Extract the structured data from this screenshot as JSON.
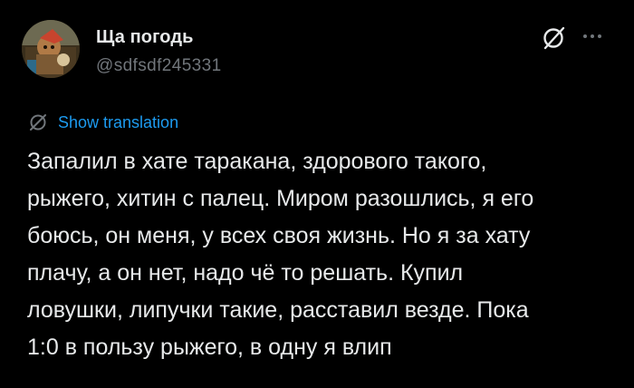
{
  "author": {
    "display_name": "Ща погодь",
    "handle": "@sdfsdf245331"
  },
  "actions": {
    "grok_icon": "grok-slash-circle-icon",
    "more_icon": "more-dots-icon"
  },
  "translation": {
    "label": "Show translation",
    "icon": "translate-slash-icon"
  },
  "tweet": {
    "text": "Запалил в хате таракана, здорового такого,\nрыжего, хитин с палец. Миром разошлись, я его\nбоюсь, он меня, у всех своя жизнь. Но я за хату\nплачу, а он нет, надо чё то решать. Купил\nловушки, липучки такие, расставил везде. Пока\n1:0 в пользу рыжего, в одну я влип"
  },
  "colors": {
    "background": "#000000",
    "text": "#e7e9ea",
    "secondary": "#71767b",
    "accent": "#1d9bf0"
  }
}
